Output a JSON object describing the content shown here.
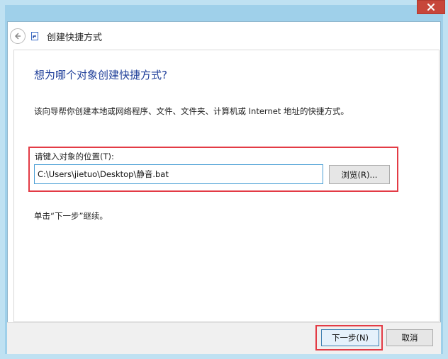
{
  "window": {
    "title": "创建快捷方式",
    "close_icon": "close-icon",
    "back_icon": "back-arrow-icon",
    "shortcut_icon": "shortcut-icon"
  },
  "main": {
    "heading": "想为哪个对象创建快捷方式?",
    "description": "该向导帮你创建本地或网络程序、文件、文件夹、计算机或 Internet 地址的快捷方式。",
    "location_label": "请键入对象的位置(T):",
    "location_value": "C:\\Users\\jietuo\\Desktop\\静音.bat",
    "browse_label": "浏览(R)...",
    "hint": "单击“下一步”继续。"
  },
  "footer": {
    "next_label": "下一步(N)",
    "cancel_label": "取消"
  },
  "colors": {
    "heading": "#1f3f9a",
    "highlight": "#e33b45",
    "close": "#c7463a"
  }
}
